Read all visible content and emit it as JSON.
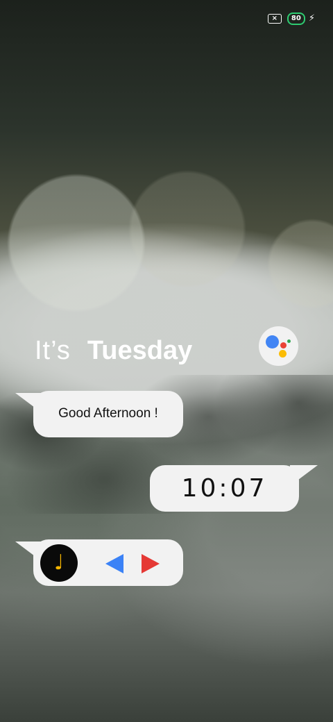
{
  "status_bar": {
    "battery_level": "80",
    "sim_icon": "sim-off-icon",
    "charging_icon": "bolt-icon",
    "battery_color": "#2ecc71"
  },
  "heading": {
    "prefix": "It’s",
    "day": "Tuesday"
  },
  "assistant": {
    "icon": "google-assistant-icon",
    "colors": [
      "#4285F4",
      "#EA4335",
      "#FBBC05",
      "#34A853"
    ]
  },
  "greeting": {
    "text": "Good Afternoon !"
  },
  "clock": {
    "time": "10:07"
  },
  "music": {
    "icon": "music-note-icon",
    "note_glyph": "♩",
    "prev_icon": "previous-icon",
    "next_icon": "next-icon",
    "prev_color": "#3b82f6",
    "next_color": "#e53935"
  }
}
